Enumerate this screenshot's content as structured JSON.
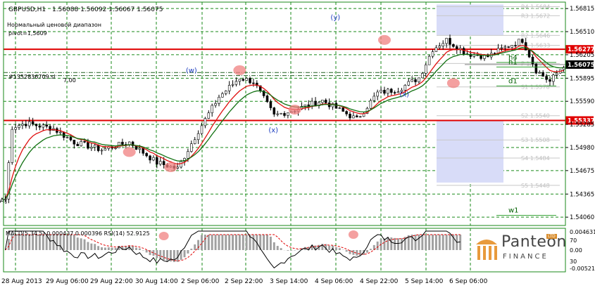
{
  "header": {
    "symbol": "GBPUSD,H1",
    "ohlc": "1.56088 1.56092 1.56067 1.56075",
    "note1": "Нормальный ценовой диапазон",
    "note2": "pivot=1,5609",
    "order_label": "#1352836709 sl",
    "order_label2": "7.00"
  },
  "panels": {
    "indicator_header": "MACD(5,34,5) 0.000437 0.000396  RSI(14) 52.9125"
  },
  "logo": {
    "brand": "Panteon",
    "sub": "FINANCE",
    "ltd": "LTD"
  },
  "chart_data": {
    "type": "candlestick",
    "x_labels": [
      "28 Aug 2013",
      "29 Aug 06:00",
      "29 Aug 22:00",
      "30 Aug 14:00",
      "2 Sep 06:00",
      "2 Sep 22:00",
      "3 Sep 14:00",
      "4 Sep 06:00",
      "4 Sep 22:00",
      "5 Sep 14:00",
      "6 Sep 06:00"
    ],
    "y_ticks": [
      "1.56815",
      "1.56510",
      "1.56205",
      "1.55895",
      "1.55590",
      "1.55285",
      "1.54980",
      "1.54675",
      "1.54365",
      "1.54060"
    ],
    "ylim": [
      1.5395,
      1.569
    ],
    "current_price": 1.56075,
    "current_label": "1.56075",
    "resistance_label": "1.56277",
    "support_label": "1.55337",
    "resistance": 1.56277,
    "support": 1.55337,
    "wave_labels": [
      {
        "text": "(w)",
        "x_index": 54,
        "price": 1.5597
      },
      {
        "text": "(x)",
        "x_index": 78,
        "price": 1.5518
      },
      {
        "text": "(y)",
        "x_index": 96,
        "price": 1.5667
      },
      {
        "text": "(x)",
        "x_index": 116,
        "price": 1.5565
      },
      {
        "text": "A]",
        "x_index": 0,
        "price": 1.5425
      }
    ],
    "pivot_levels": [
      {
        "name": "R4",
        "value": 1.5684,
        "label": "R4 1.5684"
      },
      {
        "name": "R3",
        "value": 1.5672,
        "label": "R3 1.5672"
      },
      {
        "name": "R2",
        "value": 1.5646,
        "label": "R2 1.5646"
      },
      {
        "name": "R1",
        "value": 1.5633,
        "label": "R1 1.5633"
      },
      {
        "name": "P",
        "value": 1.5609,
        "label": "P 1.5609"
      },
      {
        "name": "S1",
        "value": 1.5578,
        "label": "S1 1.5578"
      },
      {
        "name": "S2",
        "value": 1.554,
        "label": "S2 1.5540"
      },
      {
        "name": "S3",
        "value": 1.5508,
        "label": "S3 1.5508"
      },
      {
        "name": "S4",
        "value": 1.5484,
        "label": "S4 1.5484"
      },
      {
        "name": "S5",
        "value": 1.5448,
        "label": "S5 1.5448"
      }
    ],
    "side_labels": [
      {
        "text": "h4",
        "price": 1.5614
      },
      {
        "text": "h1",
        "price": 1.5608
      },
      {
        "text": "d1",
        "price": 1.5583
      },
      {
        "text": "w1",
        "price": 1.5412
      }
    ],
    "macd": {
      "ylim": [
        -0.0052,
        0.0046
      ],
      "ticks": [
        "0.004631",
        "0.00",
        "-0.00521"
      ]
    },
    "rsi": {
      "ticks": [
        "70",
        "30"
      ]
    },
    "colors": {
      "grid": "#1a8a1a",
      "bull": "#ffffff",
      "bear": "#000000",
      "ma_fast": "#e01010",
      "ma_slow": "#107010",
      "level": "#e00000",
      "pivot_box": "#d8dcf8",
      "macd_hist": "#a0a0a0",
      "rsi_line": "#000000",
      "signal_line": "#e00000",
      "marker": "#f08080",
      "wave_text": "#2040c0"
    }
  }
}
